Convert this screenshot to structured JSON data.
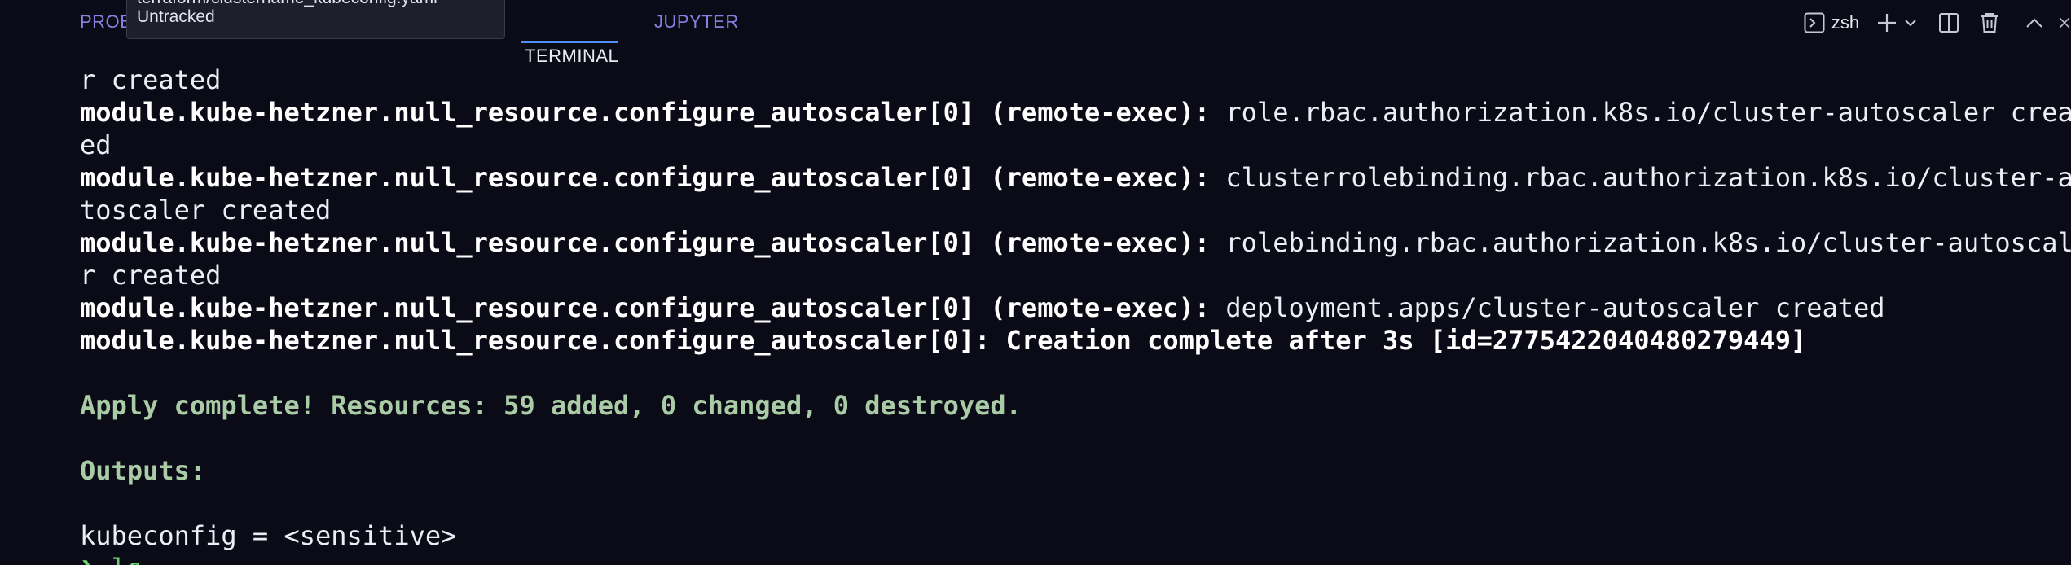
{
  "tabs": {
    "problems": "PROB",
    "terminal": "TERMINAL",
    "jupyter": "JUPYTER"
  },
  "tooltip": {
    "line1": "terraform/clustername_kubeconfig.yaml •",
    "line2": "Untracked"
  },
  "toolbar": {
    "shell_name": "zsh",
    "icons": [
      "terminal-icon",
      "plus-icon",
      "chevron-down-icon",
      "split-icon",
      "trash-icon",
      "chevron-up-icon",
      "close-icon"
    ]
  },
  "colors": {
    "background": "#0b0b17",
    "accent_tab": "#8b7fe0",
    "active_underline": "#4f8ef7",
    "apply_text": "#a9cba6",
    "prompt": "#6fcf70"
  },
  "terminal": {
    "lines": [
      {
        "prefix": "",
        "text": "r created"
      },
      {
        "prefix": "module.kube-hetzner.null_resource.configure_autoscaler[0] (remote-exec):",
        "text": " role.rbac.authorization.k8s.io/cluster-autoscaler creat"
      },
      {
        "prefix": "",
        "text": "ed"
      },
      {
        "prefix": "module.kube-hetzner.null_resource.configure_autoscaler[0] (remote-exec):",
        "text": " clusterrolebinding.rbac.authorization.k8s.io/cluster-au"
      },
      {
        "prefix": "",
        "text": "toscaler created"
      },
      {
        "prefix": "module.kube-hetzner.null_resource.configure_autoscaler[0] (remote-exec):",
        "text": " rolebinding.rbac.authorization.k8s.io/cluster-autoscale"
      },
      {
        "prefix": "",
        "text": "r created"
      },
      {
        "prefix": "module.kube-hetzner.null_resource.configure_autoscaler[0] (remote-exec):",
        "text": " deployment.apps/cluster-autoscaler created"
      },
      {
        "prefix": "module.kube-hetzner.null_resource.configure_autoscaler[0]: Creation complete after 3s [id=2775422040480279449]",
        "text": ""
      },
      {
        "prefix": "",
        "text": ""
      },
      {
        "prefix": "",
        "text": "Apply complete! Resources: 59 added, 0 changed, 0 destroyed."
      },
      {
        "prefix": "",
        "text": ""
      },
      {
        "prefix": "",
        "text": "Outputs:"
      },
      {
        "prefix": "",
        "text": ""
      },
      {
        "prefix": "",
        "text": "kubeconfig = <sensitive>"
      },
      {
        "prefix": "",
        "text": "❯ ls"
      }
    ]
  }
}
